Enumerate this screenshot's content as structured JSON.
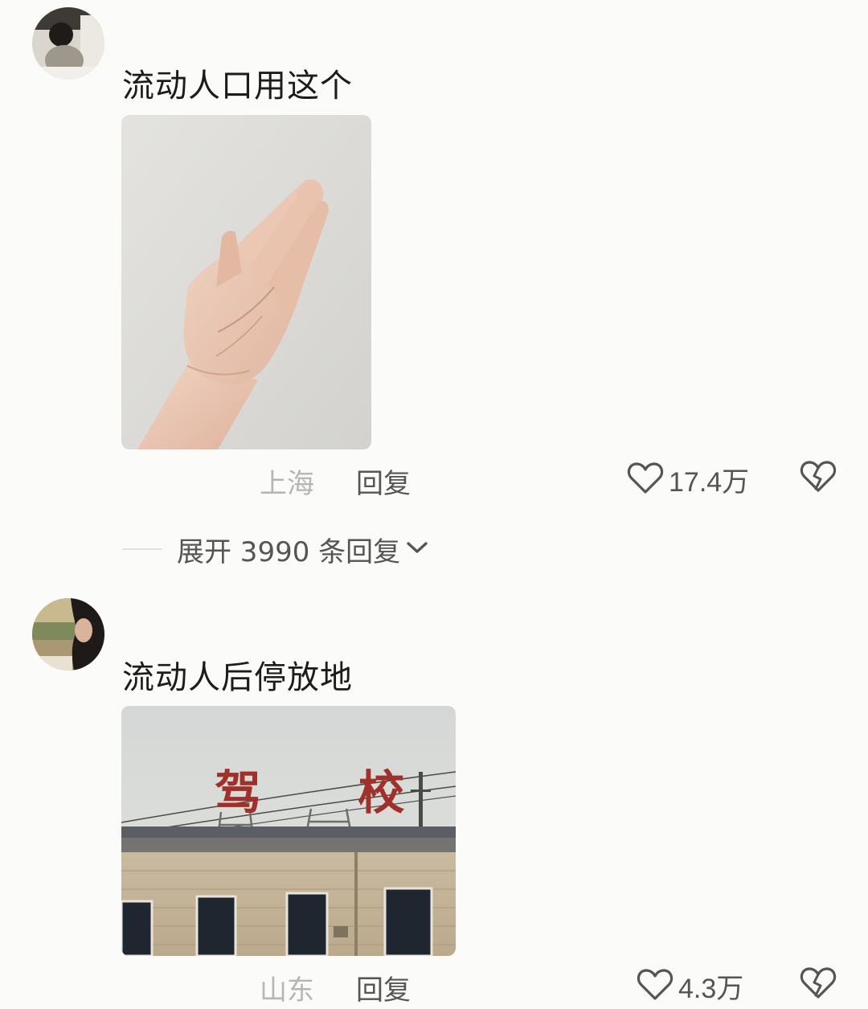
{
  "comments": [
    {
      "text": "流动人口用这个",
      "image_subject": "raised hand against white wall",
      "location": "上海",
      "reply_label": "回复",
      "like_count": "17.4万",
      "expand_replies": "展开 3990 条回复"
    },
    {
      "text": "流动人后停放地",
      "image_sign": "驾 校",
      "image_subject": "driving school building with rooftop sign",
      "location": "山东",
      "reply_label": "回复",
      "like_count": "4.3万"
    }
  ],
  "icons": {
    "like": "heart-outline-icon",
    "dislike": "broken-heart-icon",
    "expand": "chevron-down-icon"
  },
  "colors": {
    "background": "#fbfbf9",
    "text_primary": "#1c1c1c",
    "text_secondary": "#555555",
    "text_muted": "#b6b6b6"
  }
}
